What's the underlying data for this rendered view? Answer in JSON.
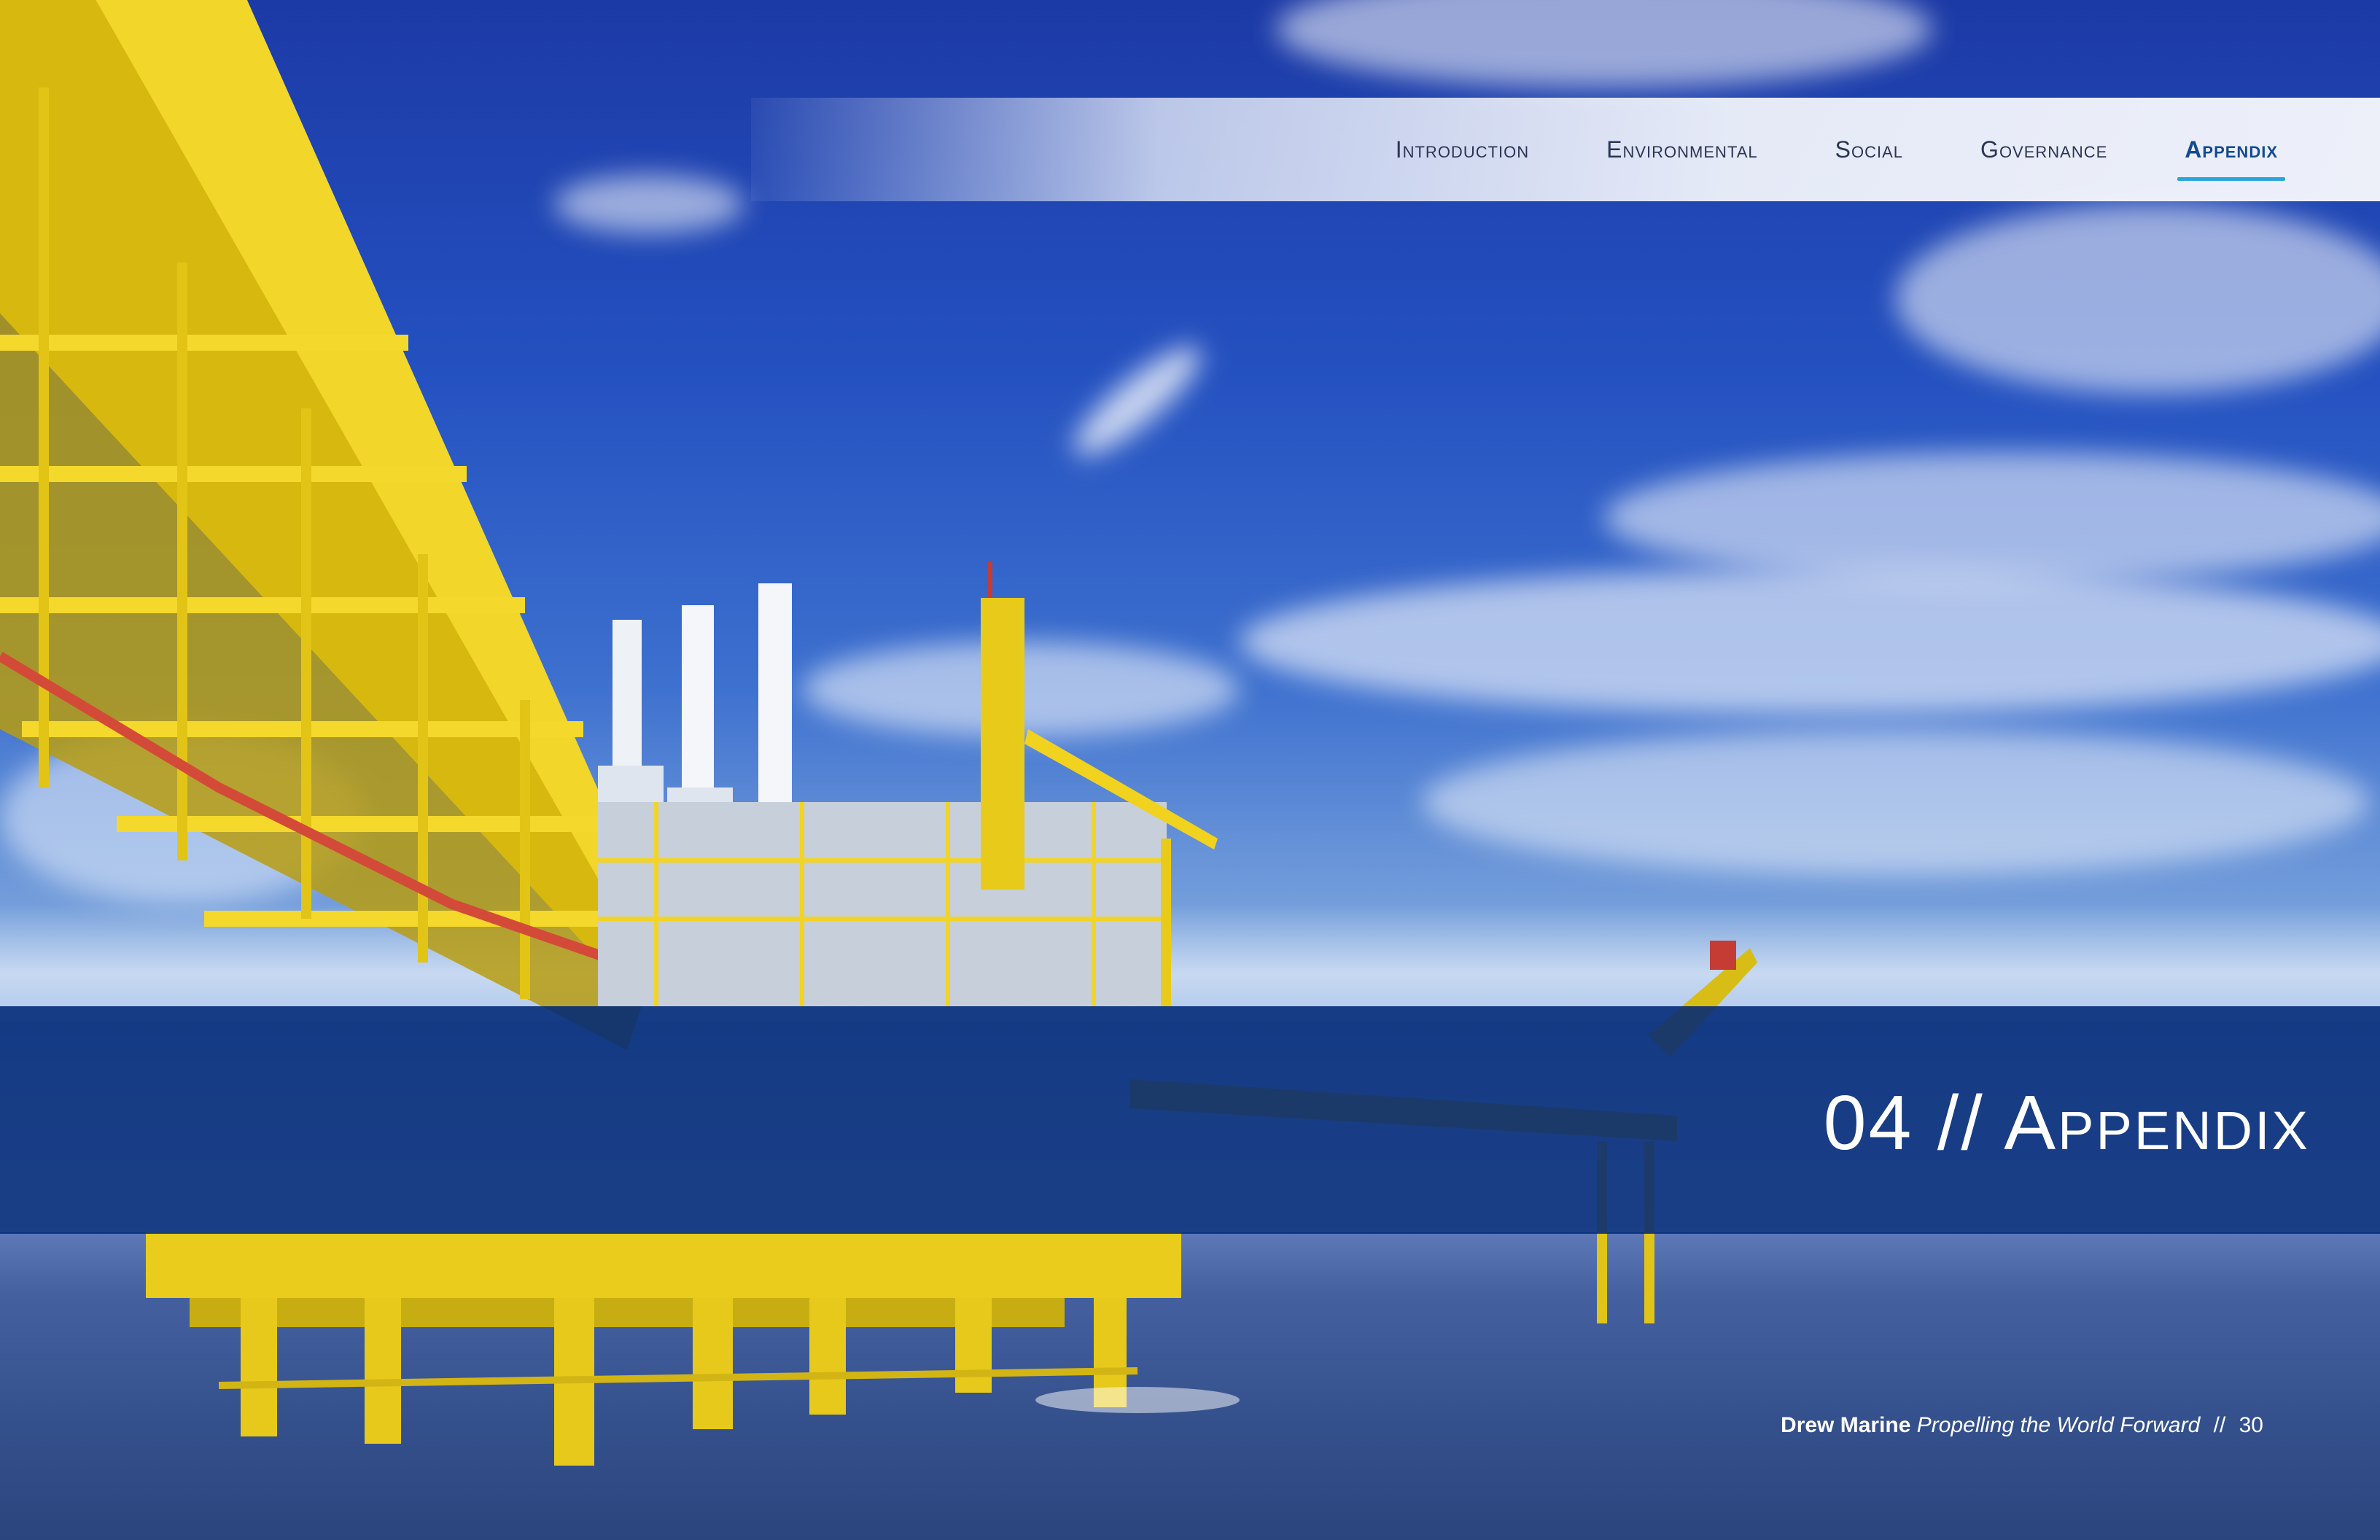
{
  "nav": {
    "items": [
      {
        "label": "Introduction",
        "active": false
      },
      {
        "label": "Environmental",
        "active": false
      },
      {
        "label": "Social",
        "active": false
      },
      {
        "label": "Governance",
        "active": false
      },
      {
        "label": "Appendix",
        "active": true
      }
    ]
  },
  "section": {
    "title": "04 // Appendix"
  },
  "footer": {
    "brand": "Drew Marine",
    "tagline": "Propelling the World Forward",
    "separator": "//",
    "page_number": "30"
  },
  "colors": {
    "band": "#00286f",
    "active_nav": "#124a94",
    "active_underline": "#29a5d9"
  }
}
